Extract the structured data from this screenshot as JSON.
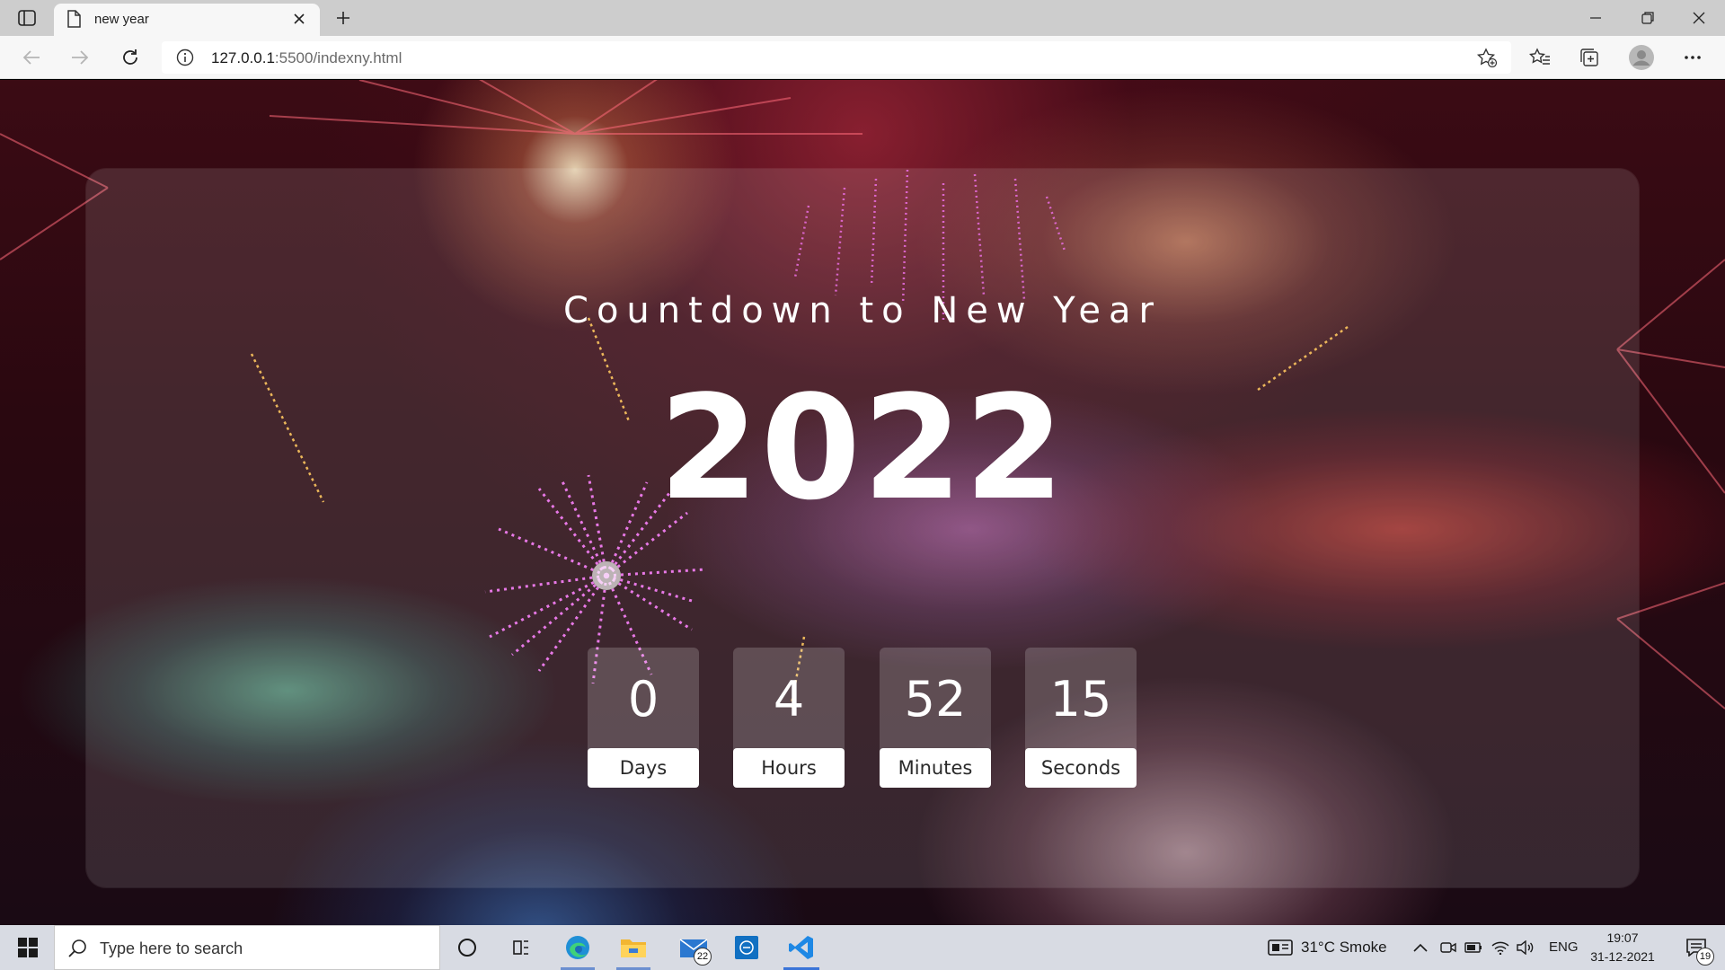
{
  "browser": {
    "tab_title": "new year",
    "url_host": "127.0.0.1",
    "url_rest": ":5500/indexny.html"
  },
  "page": {
    "heading": "Countdown to New Year",
    "year": "2022",
    "countdown": [
      {
        "value": "0",
        "label": "Days"
      },
      {
        "value": "4",
        "label": "Hours"
      },
      {
        "value": "52",
        "label": "Minutes"
      },
      {
        "value": "15",
        "label": "Seconds"
      }
    ]
  },
  "taskbar": {
    "search_placeholder": "Type here to search",
    "mail_badge": "22",
    "weather": "31°C  Smoke",
    "language": "ENG",
    "time": "19:07",
    "date": "31-12-2021",
    "notification_badge": "19",
    "active_app": "vscode"
  },
  "colors": {
    "accent": "#3a74d8",
    "glass": "rgba(255,255,255,0.12)"
  }
}
